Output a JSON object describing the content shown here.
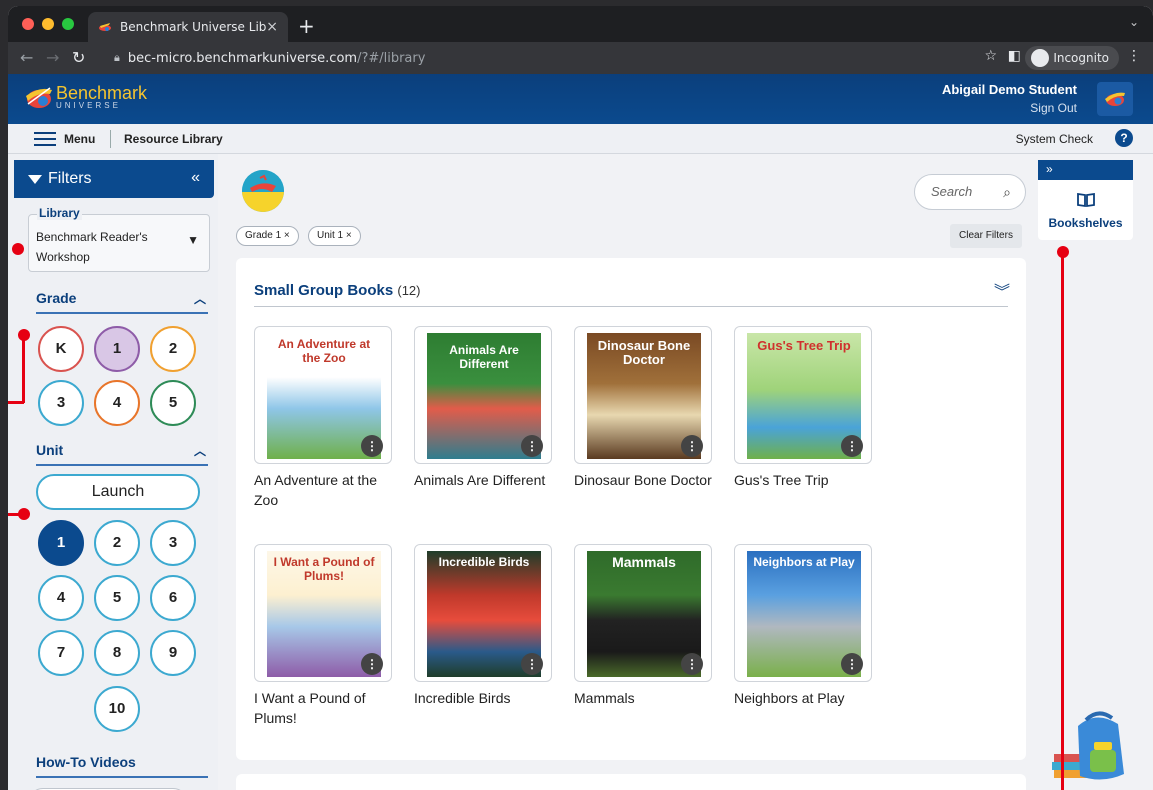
{
  "browser": {
    "tab_title": "Benchmark Universe Library",
    "tab_close": "×",
    "new_tab": "+",
    "url_host": "bec-micro.benchmarkuniverse.com",
    "url_path": "/?#/library",
    "incognito_label": "Incognito"
  },
  "app": {
    "logo_name": "Benchmark",
    "logo_sub": "UNIVERSE",
    "user_name": "Abigail Demo Student",
    "sign_out": "Sign Out"
  },
  "subnav": {
    "menu": "Menu",
    "resource_library": "Resource Library",
    "system_check": "System Check",
    "help": "?"
  },
  "sidebar": {
    "filters_title": "Filters",
    "collapse": "«",
    "library_label": "Library",
    "library_value": "Benchmark Reader's Workshop",
    "grade_title": "Grade",
    "grades": [
      "K",
      "1",
      "2",
      "3",
      "4",
      "5"
    ],
    "unit_title": "Unit",
    "launch_label": "Launch",
    "units": [
      "1",
      "2",
      "3",
      "4",
      "5",
      "6",
      "7",
      "8",
      "9",
      "10"
    ],
    "howto_title": "How-To Videos"
  },
  "main": {
    "search_placeholder": "Search",
    "chips": [
      "Grade 1  ×",
      "Unit 1  ×"
    ],
    "clear_filters": "Clear Filters",
    "section_title": "Small Group Books",
    "section_count": "(12)",
    "books": [
      {
        "title": "An Adventure at the Zoo",
        "cover_text": "An Adventure at the Zoo"
      },
      {
        "title": "Animals Are Different",
        "cover_text": "Animals Are Different"
      },
      {
        "title": "Dinosaur Bone Doctor",
        "cover_text": "Dinosaur Bone Doctor"
      },
      {
        "title": "Gus's Tree Trip",
        "cover_text": "Gus's Tree Trip"
      },
      {
        "title": "I Want a Pound of Plums!",
        "cover_text": "I Want a Pound of Plums!"
      },
      {
        "title": "Incredible Birds",
        "cover_text": "Incredible Birds"
      },
      {
        "title": "Mammals",
        "cover_text": "Mammals"
      },
      {
        "title": "Neighbors at Play",
        "cover_text": "Neighbors at Play"
      }
    ]
  },
  "right_panel": {
    "expand": "»",
    "bookshelves": "Bookshelves"
  },
  "colors": {
    "brand_blue": "#0b4a8e",
    "selected_grade": "#d9c7e6",
    "selected_unit": "#0b4a8e",
    "annotation_red": "#e60012"
  }
}
